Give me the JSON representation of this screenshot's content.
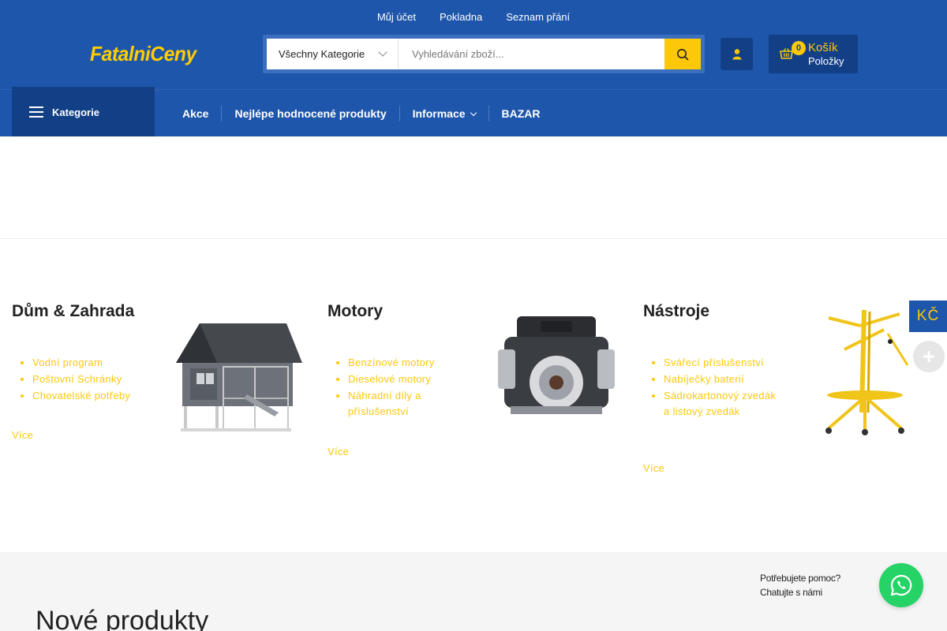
{
  "top_links": [
    "Můj účet",
    "Pokladna",
    "Seznam přání"
  ],
  "logo": {
    "part1": "Fatalni",
    "part2": "Ceny"
  },
  "search": {
    "category_selected": "Všechny Kategorie",
    "placeholder": "Vyhledávání zboží..."
  },
  "cart": {
    "count": "0",
    "title": "Košík",
    "subtitle": "Položky"
  },
  "nav": {
    "categories_label": "Kategorie",
    "items": [
      "Akce",
      "Nejlépe hodnocené produkty",
      "Informace",
      "BAZAR"
    ]
  },
  "categories": [
    {
      "title": "Dům & Zahrada",
      "links": [
        "Vodní program",
        "Poštovní Schránky",
        "Chovatelské potřeby"
      ],
      "more": "Více"
    },
    {
      "title": "Motory",
      "links": [
        "Benzínové motory",
        "Dieselové motory",
        "Náhradní díly a příslušenství"
      ],
      "more": "Více"
    },
    {
      "title": "Nástroje",
      "links": [
        "Svářecí příslušenství",
        "Nabíječky baterií",
        "Sádrokartonový zvedák a listový zvedák"
      ],
      "more": "Více"
    }
  ],
  "currency": "KČ",
  "new_products_title": "Nové produkty",
  "help": {
    "line1": "Potřebujete pomoc?",
    "line2": "Chatujte s námi"
  },
  "colors": {
    "header_blue": "#1e56ab",
    "dark_blue": "#123f86",
    "accent_yellow": "#fdc80a",
    "whatsapp_green": "#25d366"
  }
}
